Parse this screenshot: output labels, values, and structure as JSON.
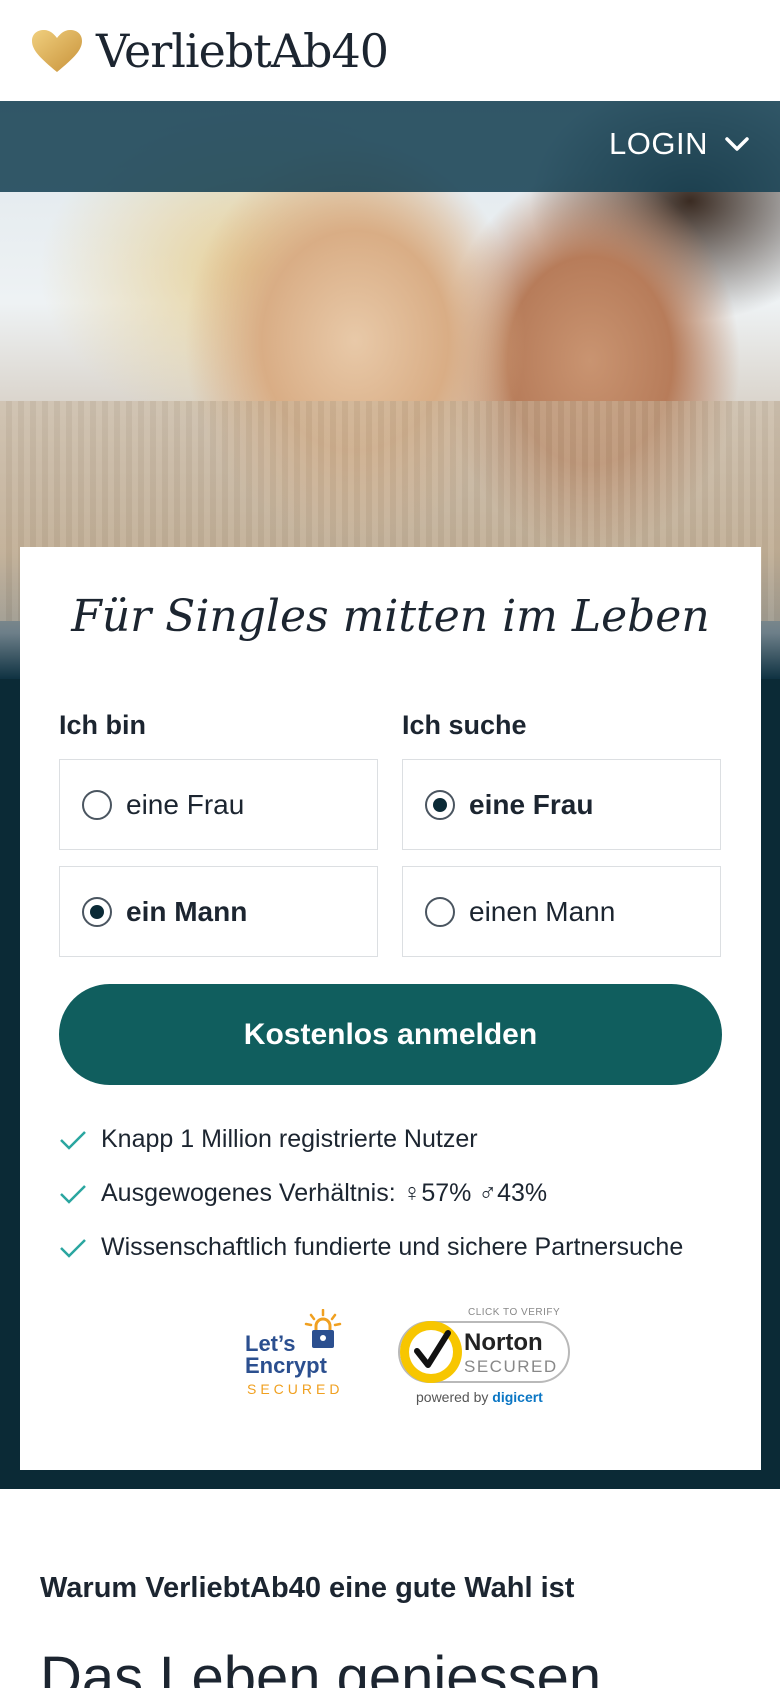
{
  "brand": {
    "name": "VerliebtAb40"
  },
  "nav": {
    "login_label": "LOGIN"
  },
  "card": {
    "title": "Für Singles mitten im Leben",
    "ich_bin": {
      "label": "Ich bin",
      "options": [
        {
          "label": "eine Frau",
          "selected": false
        },
        {
          "label": "ein Mann",
          "selected": true
        }
      ]
    },
    "ich_suche": {
      "label": "Ich suche",
      "options": [
        {
          "label": "eine Frau",
          "selected": true
        },
        {
          "label": "einen Mann",
          "selected": false
        }
      ]
    },
    "cta_label": "Kostenlos anmelden",
    "features": [
      "Knapp 1 Million registrierte Nutzer",
      "Ausgewogenes Verhältnis: ♀57% ♂43%",
      "Wissenschaftlich fundierte und sichere Partnersuche"
    ],
    "badges": {
      "letsencrypt": {
        "line1": "Let’s",
        "line2": "Encrypt",
        "secured": "SECURED"
      },
      "norton": {
        "click": "CLICK TO VERIFY",
        "name": "Norton",
        "secured": "SECURED",
        "powered_by": "powered by",
        "powered_brand": "digicert"
      }
    }
  },
  "section": {
    "heading": "Warum VerliebtAb40 eine gute Wahl ist",
    "big_heading": "Das Leben geniessen"
  },
  "colors": {
    "navbar": "#184254",
    "band": "#0b2a36",
    "cta": "#105e5e",
    "check": "#2aa6a0",
    "logo_heart": "#e2b45c"
  }
}
